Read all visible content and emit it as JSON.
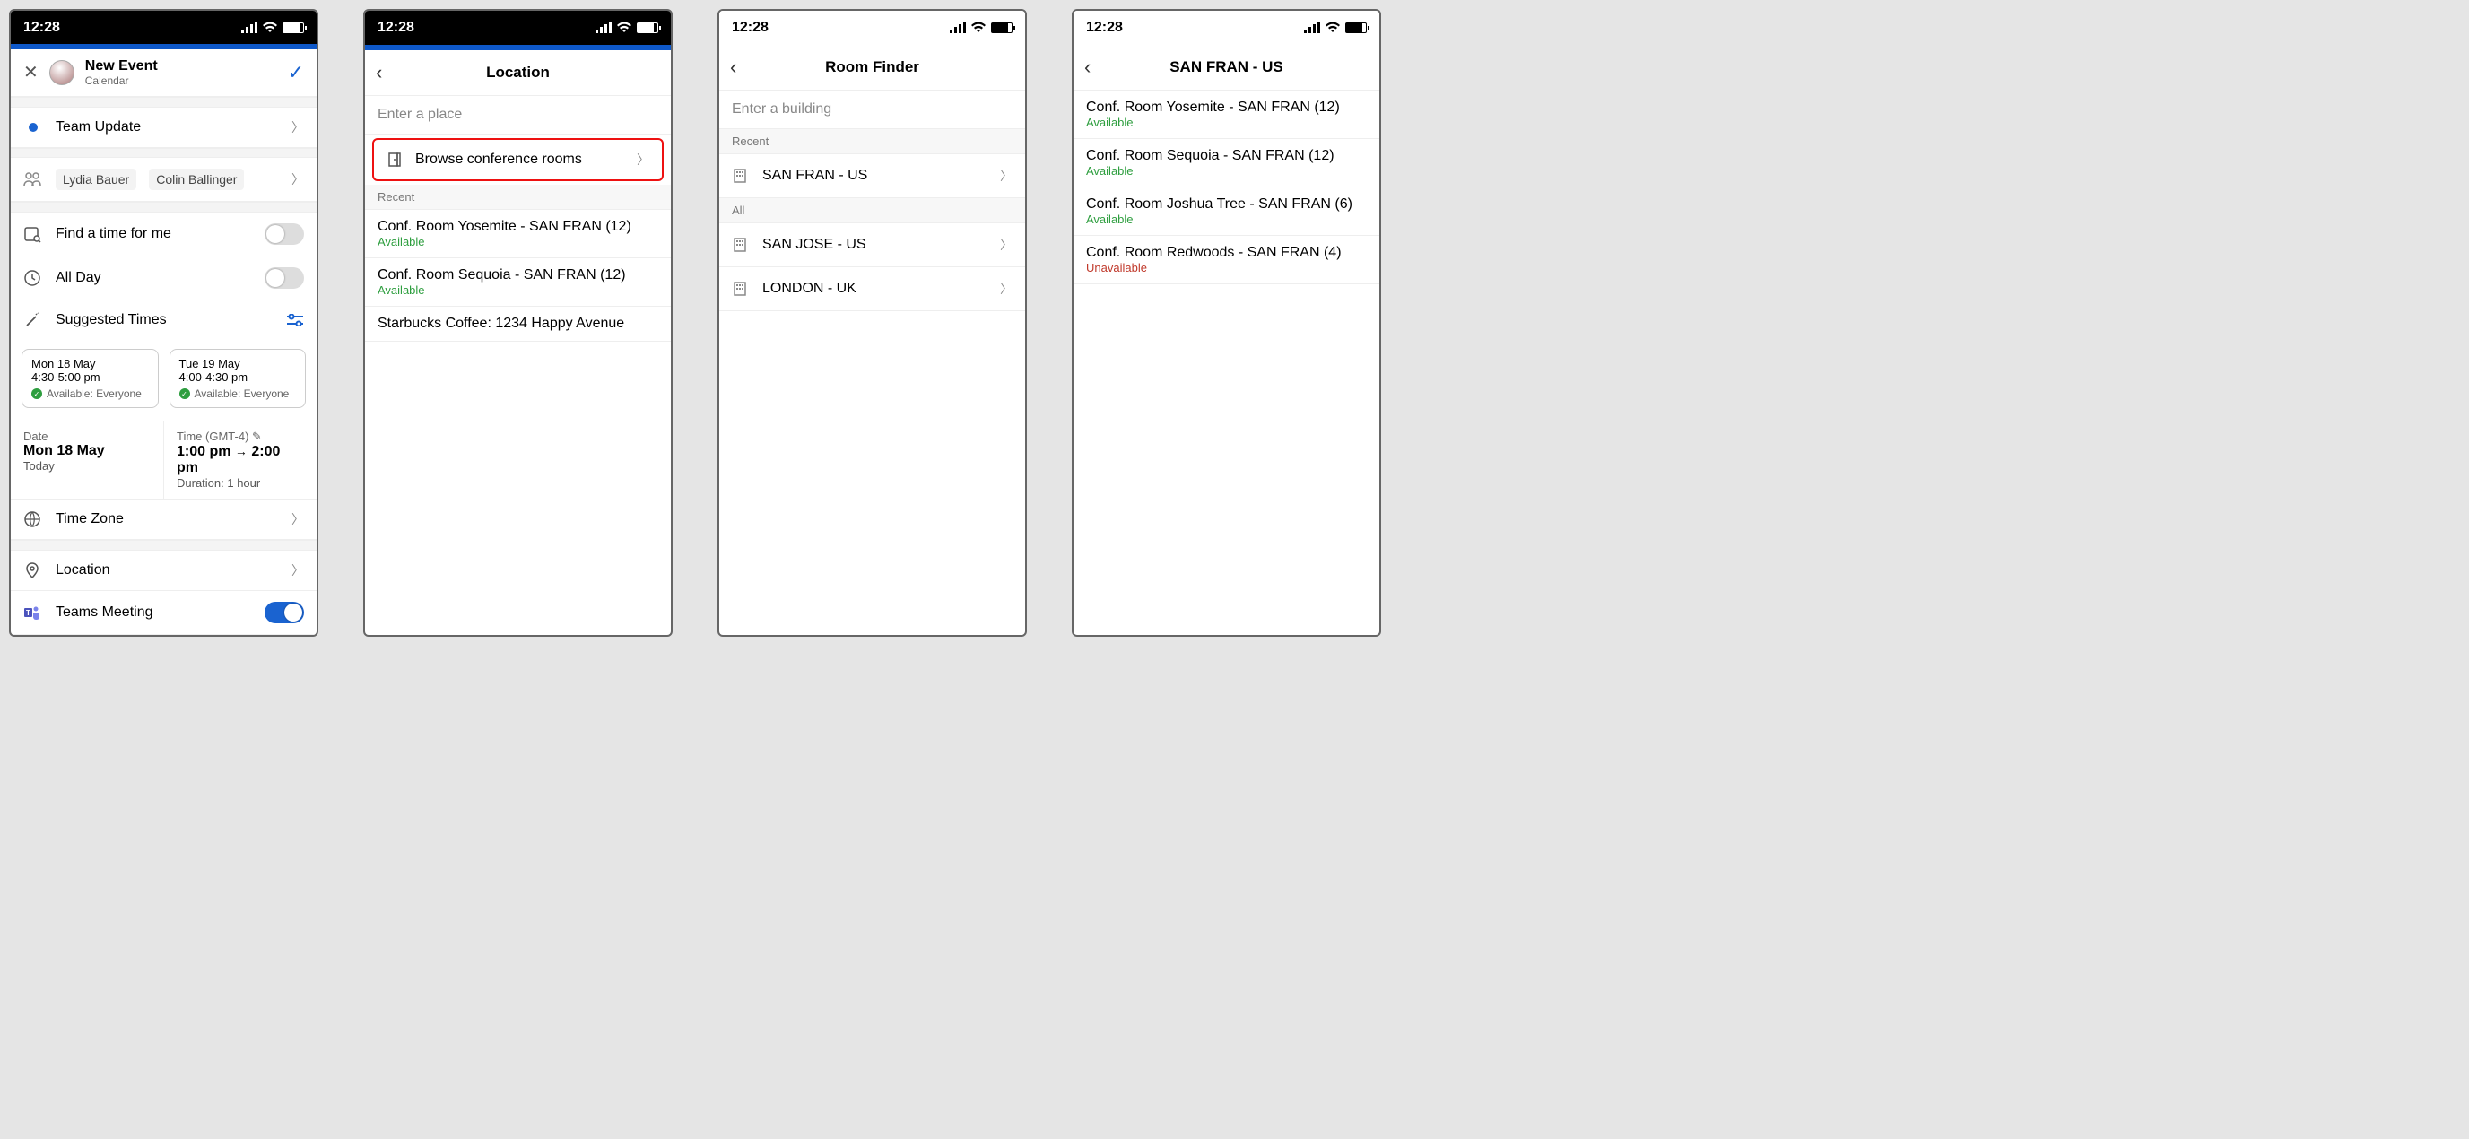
{
  "status": {
    "time": "12:28"
  },
  "screen1": {
    "title": "New Event",
    "subtitle": "Calendar",
    "event_title": "Team Update",
    "attendee1": "Lydia Bauer",
    "attendee2": "Colin Ballinger",
    "find_time": "Find a time for me",
    "all_day": "All Day",
    "suggested": "Suggested Times",
    "card1": {
      "date": "Mon 18 May",
      "time": "4:30-5:00 pm",
      "avail": "Available: Everyone"
    },
    "card2": {
      "date": "Tue 19 May",
      "time": "4:00-4:30 pm",
      "avail": "Available: Everyone"
    },
    "date_lbl": "Date",
    "date_val": "Mon 18 May",
    "date_sub": "Today",
    "time_lbl": "Time (GMT-4)",
    "time_start": "1:00 pm",
    "time_end": "2:00 pm",
    "time_dur": "Duration: 1 hour",
    "timezone": "Time Zone",
    "location": "Location",
    "teams": "Teams Meeting"
  },
  "screen2": {
    "title": "Location",
    "placeholder": "Enter a place",
    "browse": "Browse conference rooms",
    "recent": "Recent",
    "r1": {
      "name": "Conf. Room Yosemite - SAN FRAN (12)",
      "status": "Available"
    },
    "r2": {
      "name": "Conf. Room Sequoia - SAN FRAN (12)",
      "status": "Available"
    },
    "r3": "Starbucks Coffee: 1234 Happy Avenue"
  },
  "screen3": {
    "title": "Room Finder",
    "placeholder": "Enter a building",
    "recent": "Recent",
    "all": "All",
    "b1": "SAN FRAN - US",
    "b2": "SAN JOSE - US",
    "b3": "LONDON - UK"
  },
  "screen4": {
    "title": "SAN FRAN - US",
    "r1": {
      "name": "Conf. Room Yosemite - SAN FRAN (12)",
      "status": "Available"
    },
    "r2": {
      "name": "Conf. Room Sequoia - SAN FRAN (12)",
      "status": "Available"
    },
    "r3": {
      "name": "Conf. Room Joshua Tree - SAN FRAN (6)",
      "status": "Available"
    },
    "r4": {
      "name": "Conf. Room Redwoods - SAN FRAN (4)",
      "status": "Unavailable"
    }
  }
}
